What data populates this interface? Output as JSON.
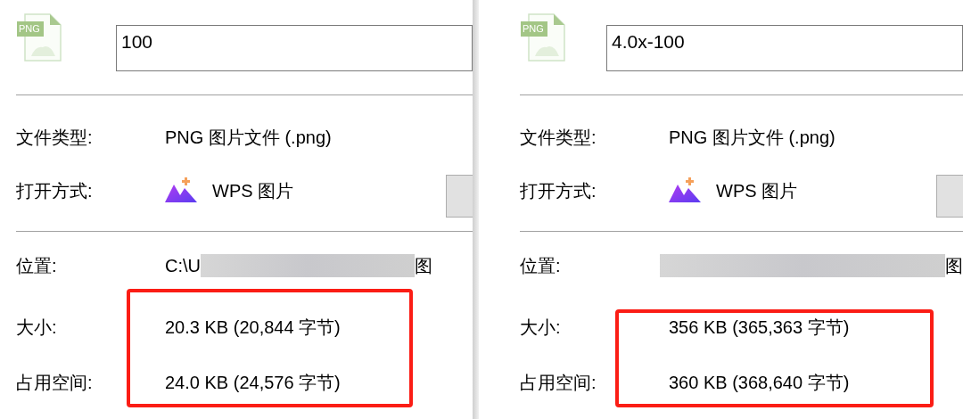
{
  "panels": [
    {
      "file_type_icon": "PNG",
      "name": "100",
      "rows": [
        {
          "kind": "text",
          "label": "文件类型:",
          "value": "PNG 图片文件 (.png)"
        },
        {
          "kind": "app",
          "label": "打开方式:",
          "value": "WPS 图片"
        }
      ],
      "location": {
        "label": "位置:",
        "visible_start": "C:\\U",
        "visible_end": "图"
      },
      "size_rows": [
        {
          "label": "大小:",
          "value": "20.3 KB (20,844 字节)"
        },
        {
          "label": "占用空间:",
          "value": "24.0 KB (24,576 字节)"
        }
      ],
      "highlighted": true
    },
    {
      "file_type_icon": "PNG",
      "name": "4.0x-100",
      "rows": [
        {
          "kind": "text",
          "label": "文件类型:",
          "value": "PNG 图片文件 (.png)"
        },
        {
          "kind": "app",
          "label": "打开方式:",
          "value": "WPS 图片"
        }
      ],
      "location": {
        "label": "位置:",
        "visible_end": "图"
      },
      "size_rows": [
        {
          "label": "大小:",
          "value": "356 KB (365,363 字节)"
        },
        {
          "label": "占用空间:",
          "value": "360 KB (368,640 字节)"
        }
      ],
      "highlighted": true
    }
  ]
}
